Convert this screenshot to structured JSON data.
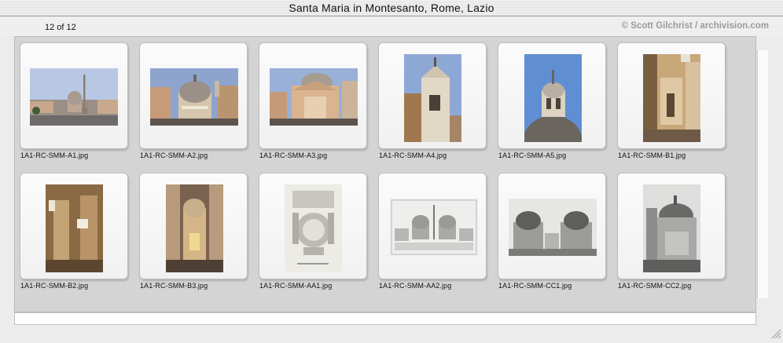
{
  "window": {
    "title": "Santa Maria in Montesanto, Rome, Lazio"
  },
  "info": {
    "count": "12 of 12",
    "credit": "© Scott Gilchrist / archivision.com"
  },
  "thumbnails": [
    {
      "filename": "1A1-RC-SMM-A1.jpg",
      "icon": "piazza-obelisk-photo"
    },
    {
      "filename": "1A1-RC-SMM-A2.jpg",
      "icon": "church-facade-photo"
    },
    {
      "filename": "1A1-RC-SMM-A3.jpg",
      "icon": "church-facade-photo"
    },
    {
      "filename": "1A1-RC-SMM-A4.jpg",
      "icon": "bell-tower-photo"
    },
    {
      "filename": "1A1-RC-SMM-A5.jpg",
      "icon": "dome-lantern-photo"
    },
    {
      "filename": "1A1-RC-SMM-B1.jpg",
      "icon": "interior-photo"
    },
    {
      "filename": "1A1-RC-SMM-B2.jpg",
      "icon": "interior-dome-photo"
    },
    {
      "filename": "1A1-RC-SMM-B3.jpg",
      "icon": "nave-interior-photo"
    },
    {
      "filename": "1A1-RC-SMM-AA1.jpg",
      "icon": "floor-plan-drawing"
    },
    {
      "filename": "1A1-RC-SMM-AA2.jpg",
      "icon": "piazza-engraving"
    },
    {
      "filename": "1A1-RC-SMM-CC1.jpg",
      "icon": "twin-churches-photo"
    },
    {
      "filename": "1A1-RC-SMM-CC2.jpg",
      "icon": "church-bw-photo"
    }
  ]
}
